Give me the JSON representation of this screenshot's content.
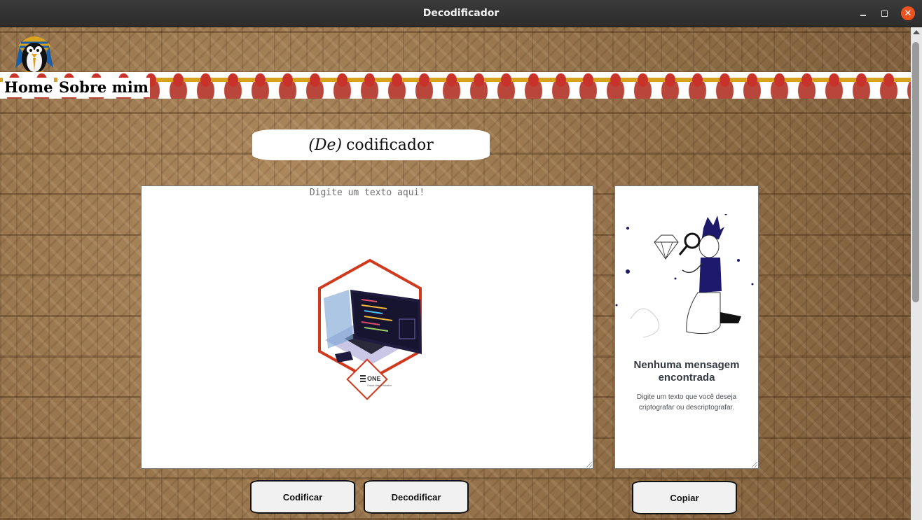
{
  "window": {
    "title": "Decodificador"
  },
  "nav": {
    "items": [
      {
        "label": "Home"
      },
      {
        "label": "Sobre mim"
      }
    ]
  },
  "header": {
    "title_prefix": "(De)",
    "title_main": "codificador"
  },
  "input": {
    "value": "",
    "placeholder": "Digite um texto aqui!"
  },
  "output": {
    "empty_title": "Nenhuma mensagem encontrada",
    "empty_description": "Digite um texto que você deseja criptografar ou descriptografar."
  },
  "laptop_badge": {
    "label": "ONE",
    "sublabel": "Oracle Next Education"
  },
  "buttons": {
    "encode": "Codificar",
    "decode": "Decodificar",
    "copy": "Copiar"
  },
  "colors": {
    "titlebar": "#2c2c2c",
    "close_button": "#e95420",
    "panel_bg": "#ffffff",
    "button_bg": "#f1f1f1",
    "figure_navy": "#1d1a6b",
    "badge_red": "#d0391e"
  }
}
